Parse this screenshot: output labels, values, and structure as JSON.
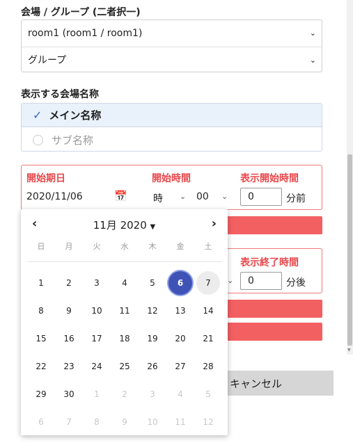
{
  "venue": {
    "label": "会場 / グループ (二者択一)",
    "room_value": "room1 (room1 / room1)",
    "group_value": "グループ"
  },
  "display_name": {
    "label": "表示する会場名称",
    "options": [
      "メイン名称",
      "サブ名称"
    ],
    "selected": "メイン名称"
  },
  "start": {
    "date_label": "開始期日",
    "date_value": "2020/11/06",
    "time_label": "開始時間",
    "hour_placeholder": "時",
    "minute_value": "00",
    "display_label": "表示開始時間",
    "display_value": "0",
    "display_unit": "分前"
  },
  "end": {
    "display_label": "表示終了時間",
    "display_value": "0",
    "display_unit": "分後"
  },
  "buttons": {
    "cancel": "キャンセル"
  },
  "calendar": {
    "title": "11月 2020",
    "prev": "‹",
    "next": "›",
    "weekdays": [
      "日",
      "月",
      "火",
      "水",
      "木",
      "金",
      "土"
    ],
    "selected_day": "6",
    "hovered_day": "7",
    "weeks": [
      [
        "1",
        "2",
        "3",
        "4",
        "5",
        "6",
        "7"
      ],
      [
        "8",
        "9",
        "10",
        "11",
        "12",
        "13",
        "14"
      ],
      [
        "15",
        "16",
        "17",
        "18",
        "19",
        "20",
        "21"
      ],
      [
        "22",
        "23",
        "24",
        "25",
        "26",
        "27",
        "28"
      ],
      [
        "29",
        "30",
        "1",
        "2",
        "3",
        "4",
        "5"
      ],
      [
        "6",
        "7",
        "8",
        "9",
        "10",
        "11",
        "12"
      ]
    ]
  },
  "colors": {
    "accent": "#3e53b5",
    "error": "#e8474b",
    "error_bar": "#f26062"
  }
}
